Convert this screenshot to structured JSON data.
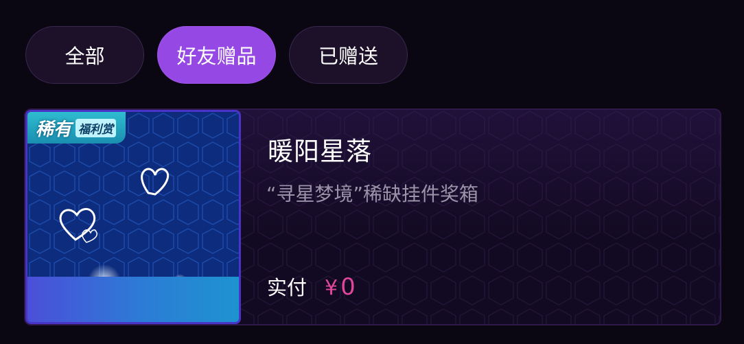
{
  "tabs": [
    {
      "label": "全部",
      "active": false
    },
    {
      "label": "好友赠品",
      "active": true
    },
    {
      "label": "已赠送",
      "active": false
    }
  ],
  "colors": {
    "active_tab": "#9548e3",
    "price": "#e0479b"
  },
  "gift": {
    "badge_main": "稀有",
    "badge_sub": "福利赏",
    "title": "暖阳星落",
    "subtitle": "“寻星梦境”稀缺挂件奖箱",
    "price_label": "实付",
    "currency": "¥",
    "price": "0"
  }
}
